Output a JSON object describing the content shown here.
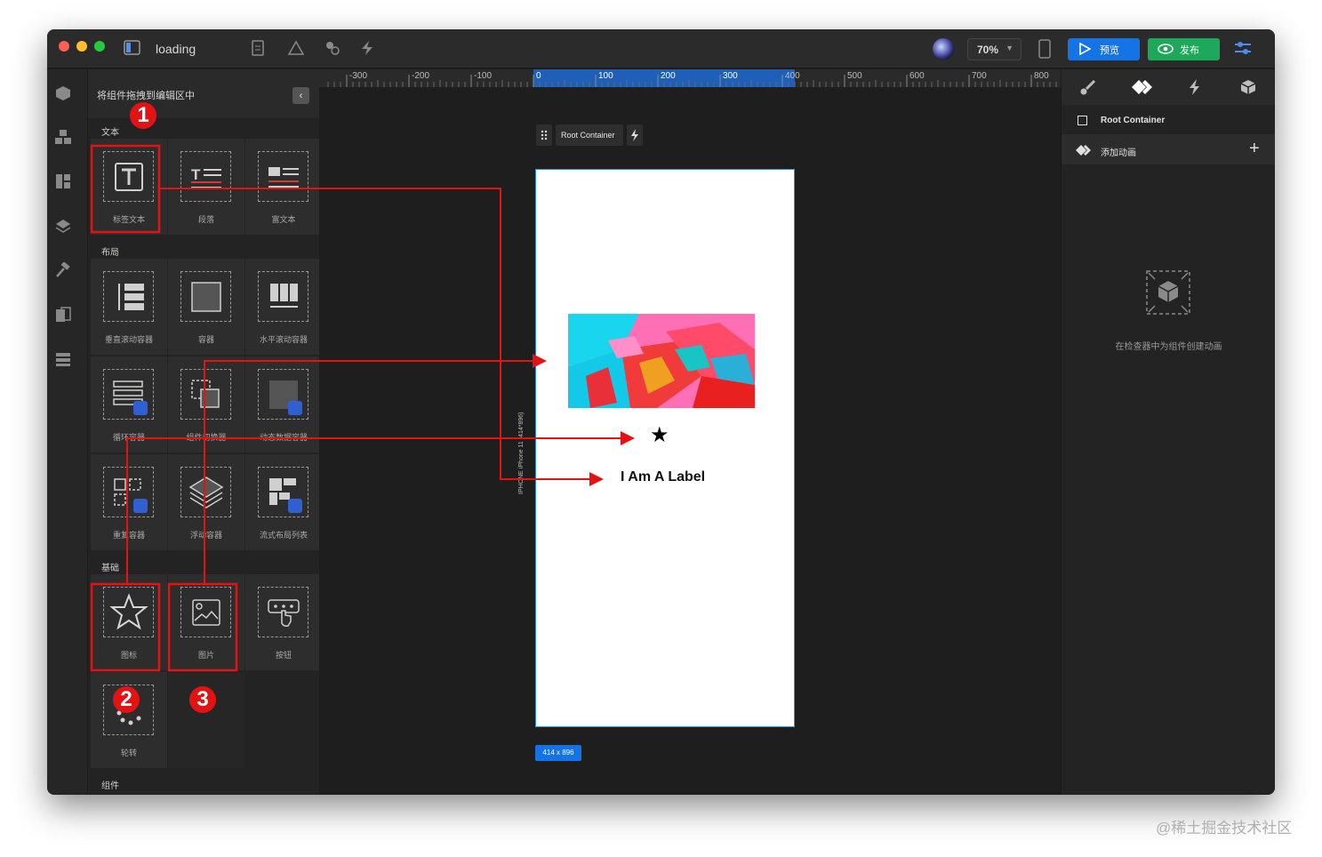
{
  "window": {
    "title": "loading",
    "zoom": "70%",
    "preview_label": "预览",
    "publish_label": "发布"
  },
  "panel": {
    "title": "将组件拖拽到编辑区中",
    "sections": {
      "text": "文本",
      "layout": "布局",
      "basic": "基础",
      "components": "组件"
    },
    "tiles": {
      "label_text": "标签文本",
      "paragraph": "段落",
      "rich_text": "富文本",
      "vertical_scroll": "垂直滚动容器",
      "container": "容器",
      "horizontal_scroll": "水平滚动容器",
      "loop_container": "循环容器",
      "component_switcher": "组件切换器",
      "dynamic_data_container": "动态数据容器",
      "repeat_container": "重复容器",
      "float_container": "浮动容器",
      "flow_list": "流式布局列表",
      "icon": "图标",
      "image": "图片",
      "button": "按钮",
      "carousel": "轮转"
    }
  },
  "canvas": {
    "ruler_ticks": [
      "-300",
      "-200",
      "-100",
      "0",
      "100",
      "200",
      "300",
      "400",
      "500",
      "600",
      "700",
      "800"
    ],
    "root_container_label": "Root Container",
    "label_text": "I Am A Label",
    "device_name": "IPHONE   iPhone 11 (414*896)",
    "size_badge": "414 x 896"
  },
  "inspector": {
    "root_container": "Root Container",
    "add_animation": "添加动画",
    "empty_hint": "在检查器中为组件创建动画"
  },
  "annotations": [
    "1",
    "2",
    "3"
  ],
  "watermark": "@稀土掘金技术社区",
  "colors": {
    "accent_blue": "#1473e6",
    "publish_green": "#1ea85a",
    "annotation_red": "#e31313",
    "background": "#1e1e1e"
  }
}
